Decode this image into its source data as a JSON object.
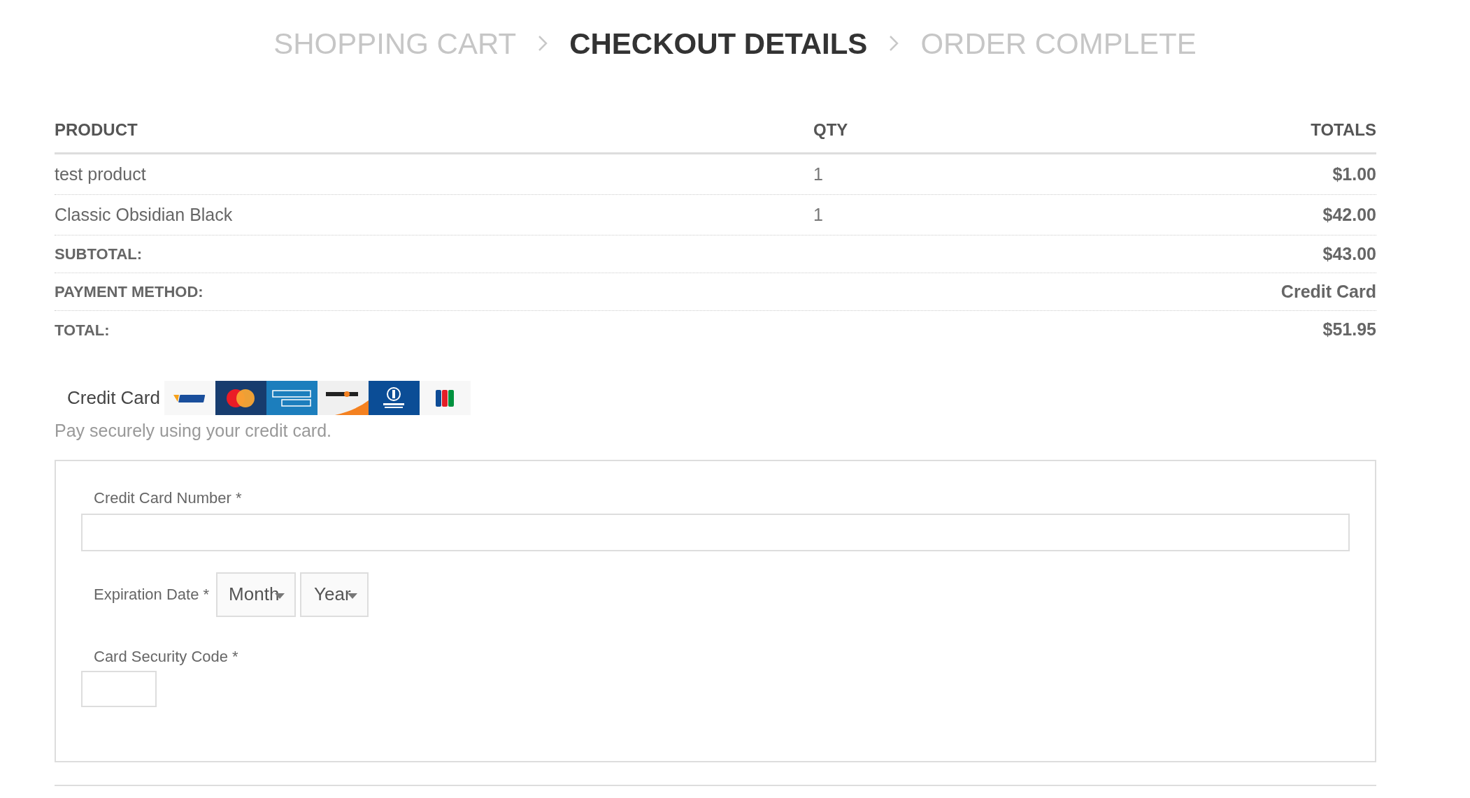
{
  "steps": [
    {
      "label": "SHOPPING CART",
      "selected": false
    },
    {
      "label": "CHECKOUT DETAILS",
      "selected": true
    },
    {
      "label": "ORDER COMPLETE",
      "selected": false
    }
  ],
  "table": {
    "columns": [
      "PRODUCT",
      "QTY",
      "TOTALS"
    ],
    "rows": [
      {
        "product": "test product",
        "qty": "1",
        "total": "$1.00"
      },
      {
        "product": "Classic Obsidian Black",
        "qty": "1",
        "total": "$42.00"
      }
    ],
    "summary": [
      {
        "label": "SUBTOTAL:",
        "value": "$43.00"
      },
      {
        "label": "PAYMENT METHOD:",
        "value": "Credit Card"
      },
      {
        "label": "TOTAL:",
        "value": "$51.95"
      }
    ]
  },
  "payment": {
    "label": "Credit Card",
    "description": "Pay securely using your credit card.",
    "card_number": {
      "label": "Credit Card Number *"
    },
    "expiration": {
      "label": "Expiration Date *",
      "month": "Month",
      "year": "Year"
    },
    "security_code": {
      "label": "Card Security Code *"
    }
  }
}
